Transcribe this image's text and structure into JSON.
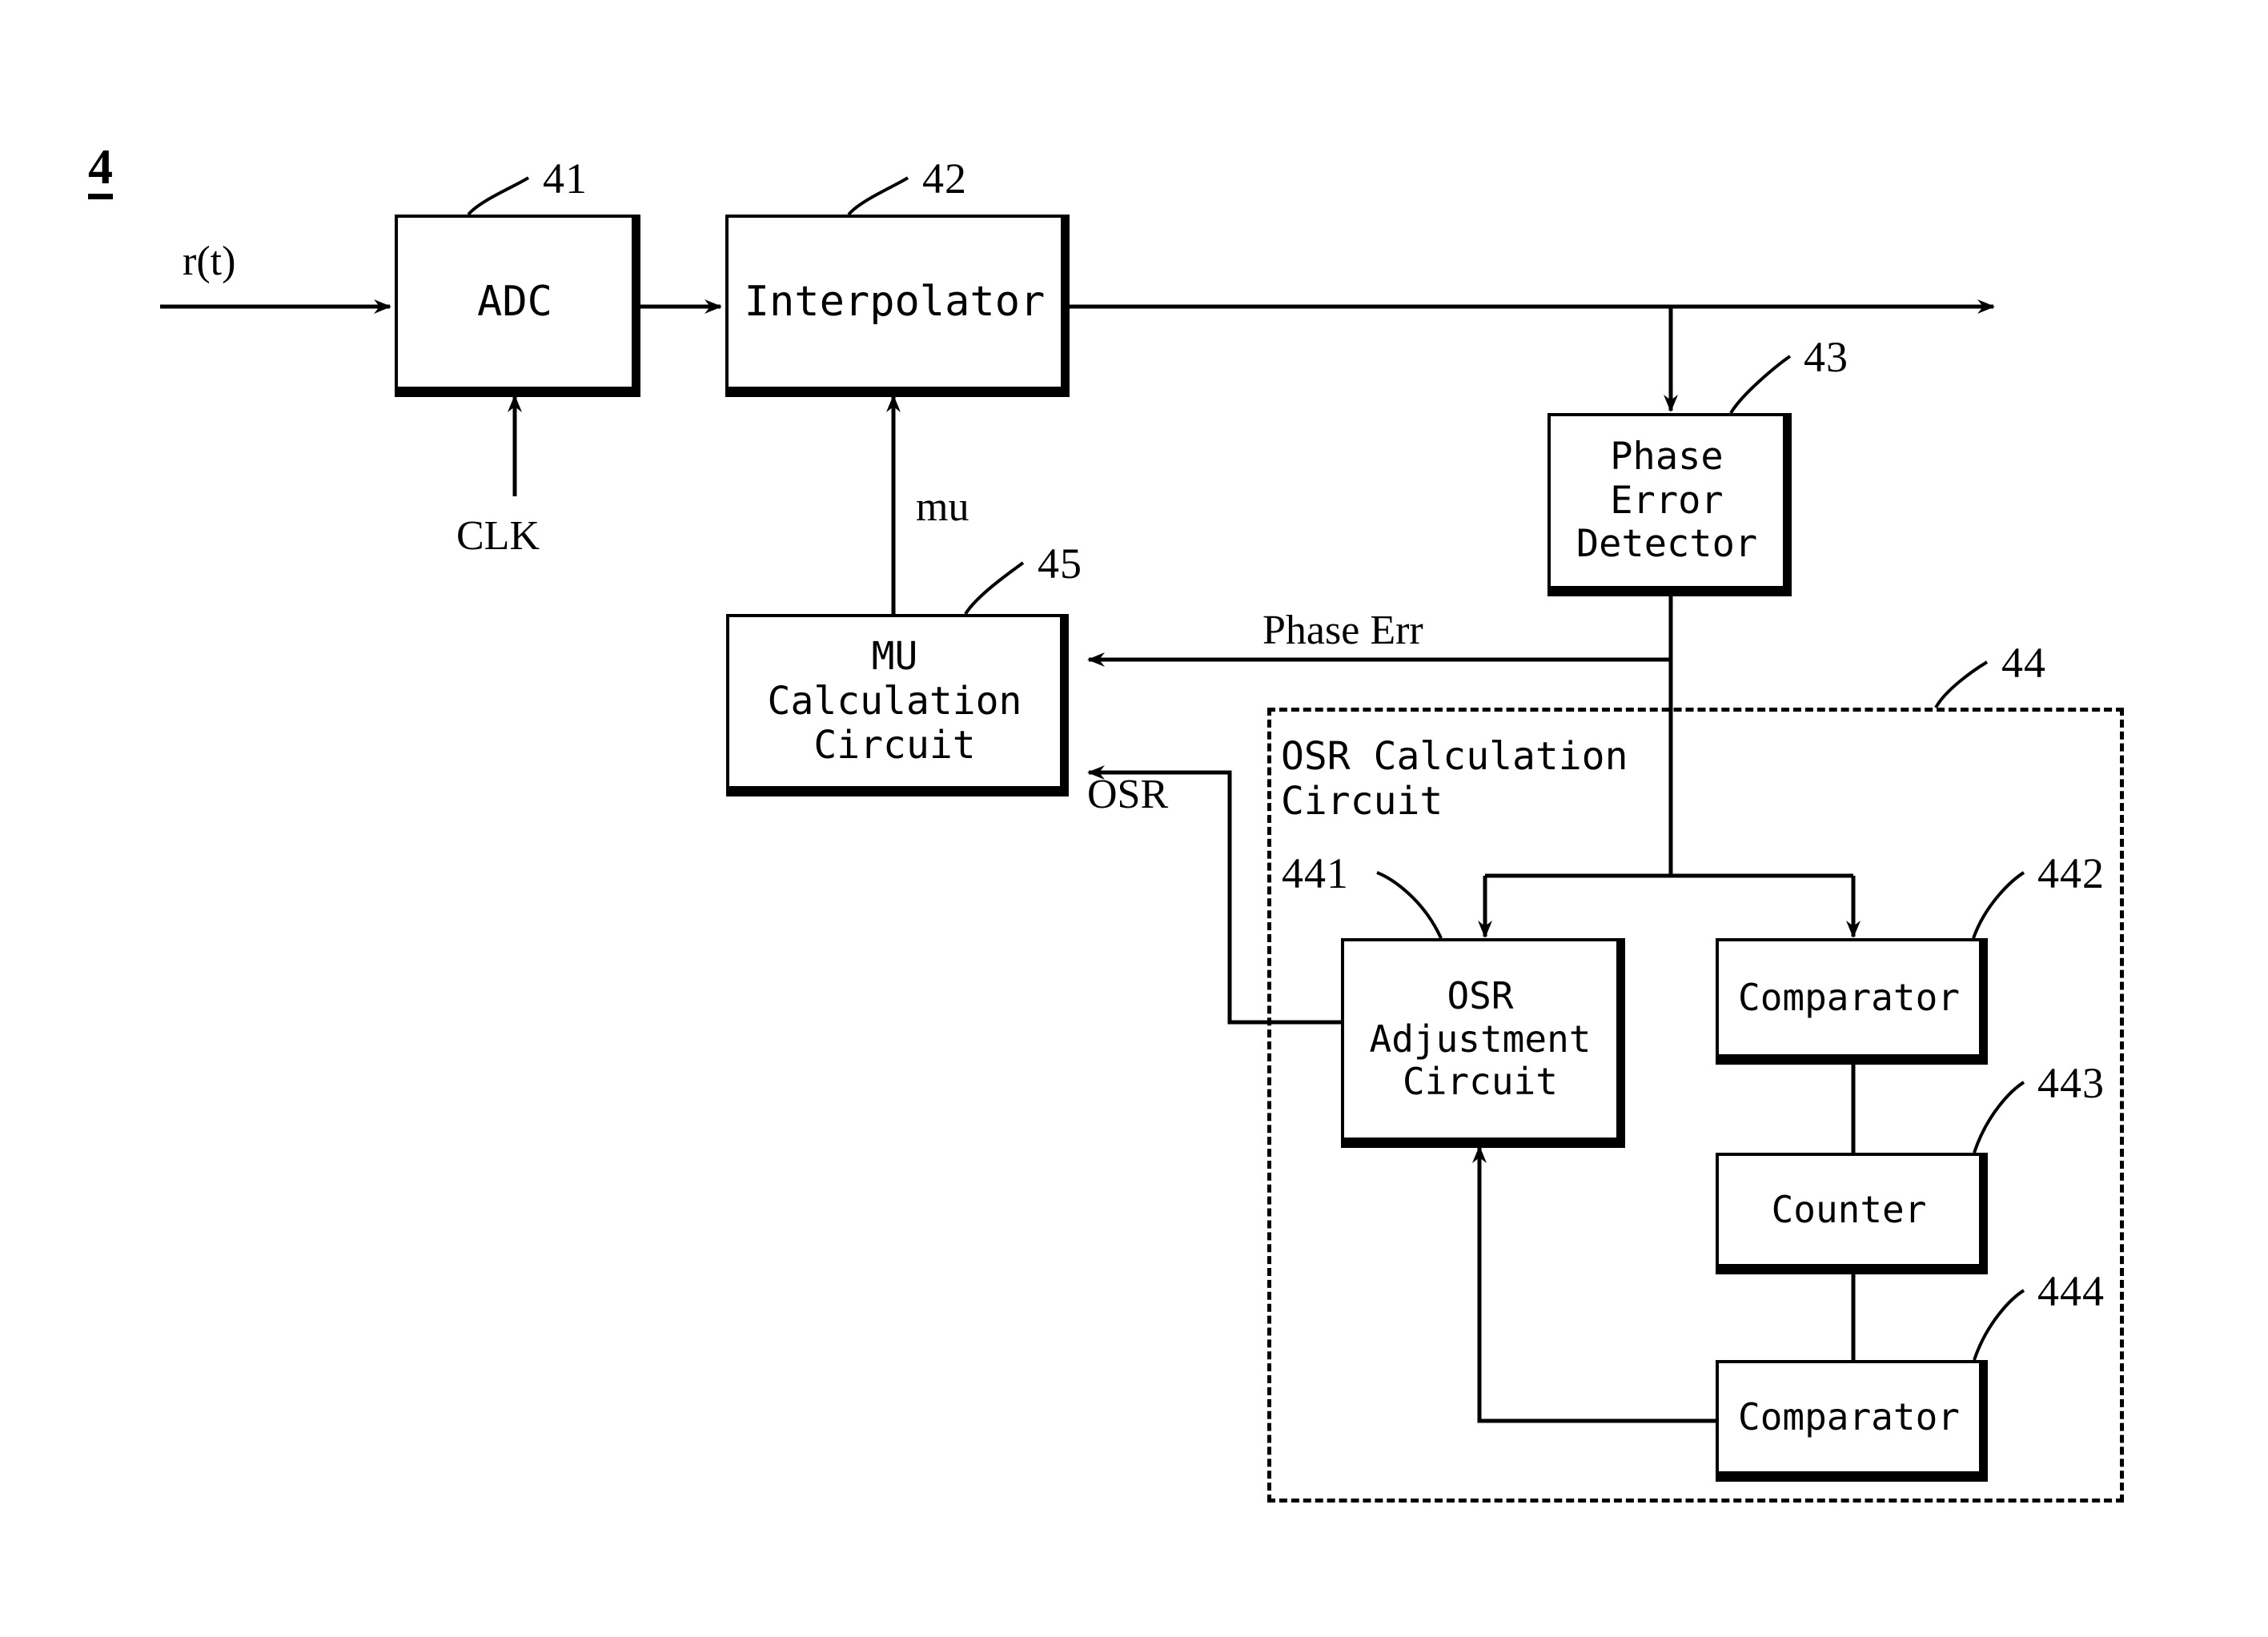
{
  "figure": {
    "id_label": "4"
  },
  "signals": {
    "input": "r(t)",
    "clock": "CLK",
    "mu": "mu",
    "phase_err": "Phase Err",
    "osr": "OSR"
  },
  "blocks": {
    "adc": {
      "label": "ADC",
      "ref": "41"
    },
    "interpolator": {
      "label": "Interpolator",
      "ref": "42"
    },
    "phase_error_detector": {
      "label": "Phase\nError\nDetector",
      "ref": "43"
    },
    "mu_calculation_circuit": {
      "label": "MU\nCalculation\nCircuit",
      "ref": "45"
    },
    "osr_calculation_circuit": {
      "label": "OSR Calculation\nCircuit",
      "ref": "44"
    },
    "osr_adjustment_circuit": {
      "label": "OSR\nAdjustment\nCircuit",
      "ref": "441"
    },
    "comparator_upper": {
      "label": "Comparator",
      "ref": "442"
    },
    "counter": {
      "label": "Counter",
      "ref": "443"
    },
    "comparator_lower": {
      "label": "Comparator",
      "ref": "444"
    }
  },
  "colors": {
    "ink": "#000000",
    "paper": "#ffffff"
  }
}
